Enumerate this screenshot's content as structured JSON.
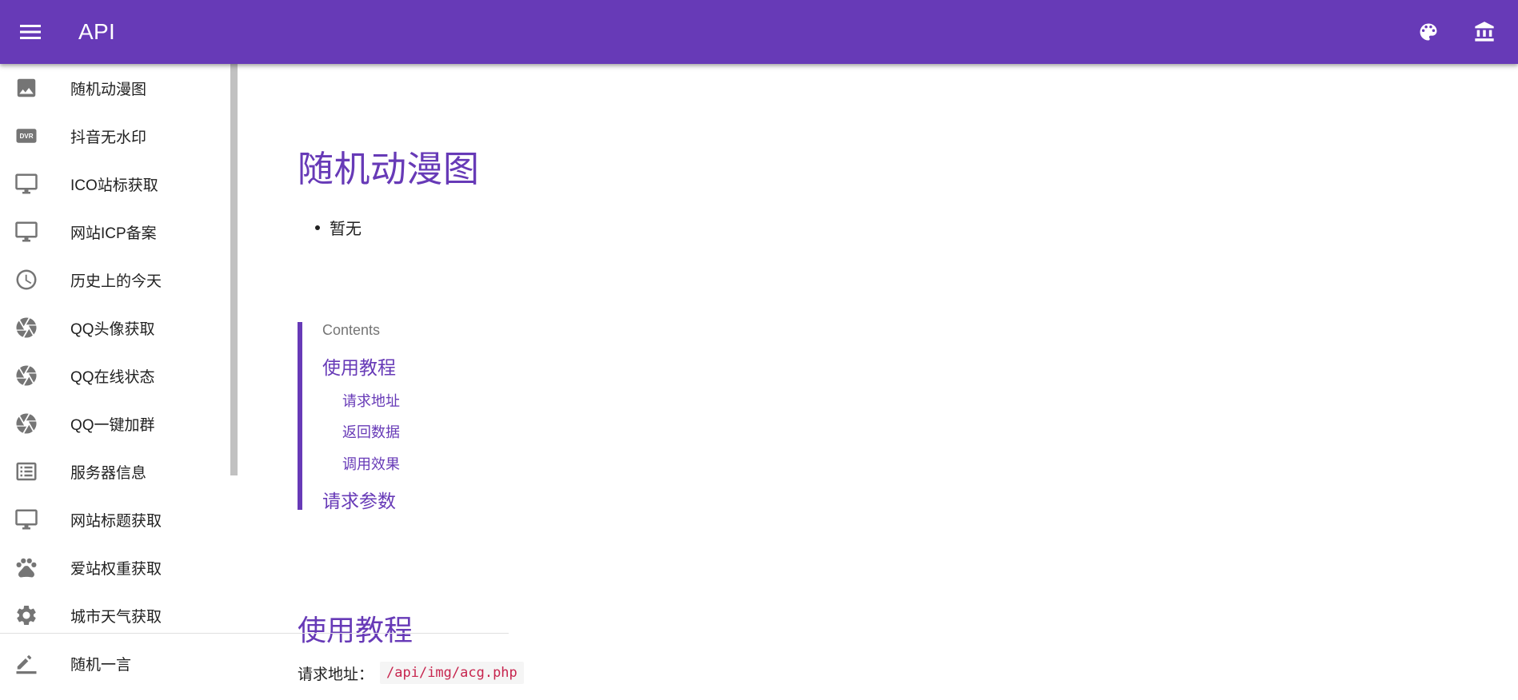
{
  "appbar": {
    "title": "API",
    "background": "#673ab7",
    "menu_icon": "menu-icon",
    "actions": [
      "palette-icon",
      "bank-icon"
    ]
  },
  "sidebar": {
    "items": [
      {
        "label": "随机动漫图",
        "icon": "image-icon"
      },
      {
        "label": "抖音无水印",
        "icon": "dvr-icon"
      },
      {
        "label": "ICO站标获取",
        "icon": "desktop-icon"
      },
      {
        "label": "网站ICP备案",
        "icon": "desktop-icon"
      },
      {
        "label": "历史上的今天",
        "icon": "clock-icon"
      },
      {
        "label": "QQ头像获取",
        "icon": "camera-shutter-icon"
      },
      {
        "label": "QQ在线状态",
        "icon": "camera-shutter-icon"
      },
      {
        "label": "QQ一键加群",
        "icon": "camera-shutter-icon"
      },
      {
        "label": "服务器信息",
        "icon": "list-icon"
      },
      {
        "label": "网站标题获取",
        "icon": "desktop-icon"
      },
      {
        "label": "爱站权重获取",
        "icon": "paw-icon"
      },
      {
        "label": "城市天气获取",
        "icon": "gear-icon"
      },
      {
        "label": "随机一言",
        "icon": "pencil-icon"
      }
    ]
  },
  "main": {
    "title": "随机动漫图",
    "notes": [
      "暂无"
    ],
    "toc": {
      "heading": "Contents",
      "sections": [
        {
          "label": "使用教程",
          "children": [
            "请求地址",
            "返回数据",
            "调用效果"
          ]
        },
        {
          "label": "请求参数",
          "children": []
        }
      ]
    },
    "section_title": "使用教程",
    "request_label": "请求地址：",
    "request_path": "/api/img/acg.php"
  },
  "colors": {
    "accent": "#673ab7",
    "code": "#c7254e"
  }
}
